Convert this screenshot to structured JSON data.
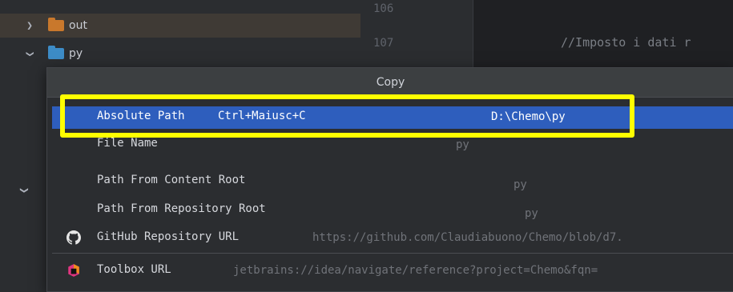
{
  "project_tree": {
    "items": [
      {
        "label": "out",
        "expanded": false,
        "folder_color": "#c9782c"
      },
      {
        "label": "py",
        "expanded": true,
        "folder_color": "#3d8cc7"
      }
    ]
  },
  "editor": {
    "line_numbers": [
      "106",
      "107"
    ],
    "code_lines": [
      "//Imposto i dati r",
      "…"
    ]
  },
  "popup": {
    "title": "Copy",
    "items": [
      {
        "label": "Absolute Path",
        "shortcut": "Ctrl+Maiusc+C",
        "value": "D:\\Chemo\\py",
        "selected": true
      },
      {
        "label": "File Name",
        "value": "py"
      },
      {
        "label": "Path From Content Root",
        "value": "py"
      },
      {
        "label": "Path From Repository Root",
        "value": "py"
      },
      {
        "label": "GitHub Repository URL",
        "value": "https://github.com/Claudiabuono/Chemo/blob/d7.",
        "icon": "github-icon"
      },
      {
        "label": "Toolbox URL",
        "value": "jetbrains://idea/navigate/reference?project=Chemo&fqn=",
        "icon": "toolbox-icon"
      }
    ]
  },
  "colors": {
    "selection": "#2e5ebd",
    "highlight_box": "#ffff00"
  }
}
